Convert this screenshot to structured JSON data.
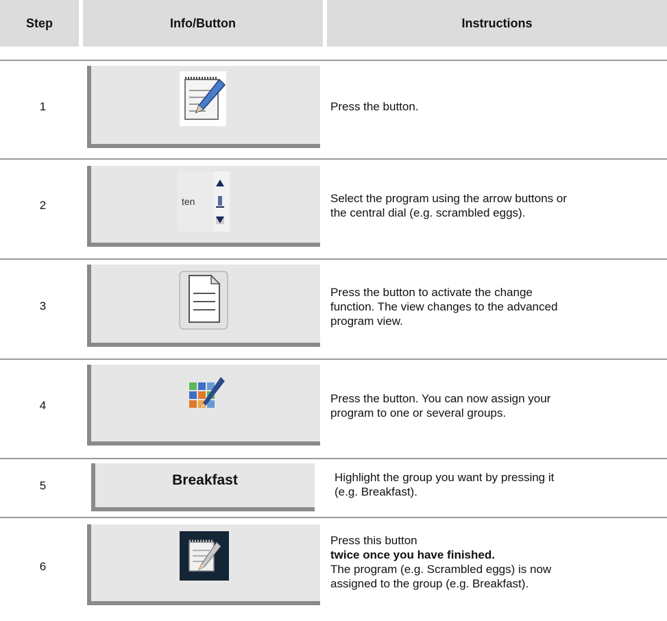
{
  "header": {
    "step": "Step",
    "info": "Info/Button",
    "instructions": "Instructions"
  },
  "rows": [
    {
      "step": "1",
      "icon": "notepad-pencil-icon",
      "instructions": [
        "Press the button."
      ]
    },
    {
      "step": "2",
      "icon": "program-selector",
      "selector_value": "ten",
      "instructions": [
        "Select the program using the arrow buttons or",
        "the central dial (e.g. scrambled eggs)."
      ]
    },
    {
      "step": "3",
      "icon": "document-icon",
      "instructions": [
        "Press the button to activate the change",
        "function. The view changes to the advanced",
        "program view."
      ]
    },
    {
      "step": "4",
      "icon": "group-assign-icon",
      "instructions": [
        "Press the button. You can now assign your",
        "program to one or several groups."
      ]
    },
    {
      "step": "5",
      "button_label": "Breakfast",
      "instructions": [
        "Highlight the group you want by pressing it",
        "(e.g. Breakfast)."
      ]
    },
    {
      "step": "6",
      "icon": "notepad-pencil-dark-icon",
      "instructions": [
        "Press this button",
        "twice once you have finished.",
        "The program (e.g. Scrambled eggs) is now",
        "assigned to the group (e.g. Breakfast)."
      ]
    }
  ],
  "colors": {
    "header_bg": "#dcdcdc",
    "button_bg": "#e6e6e6",
    "button_shadow": "#8a8a8a",
    "rule": "#9a9a9a"
  }
}
